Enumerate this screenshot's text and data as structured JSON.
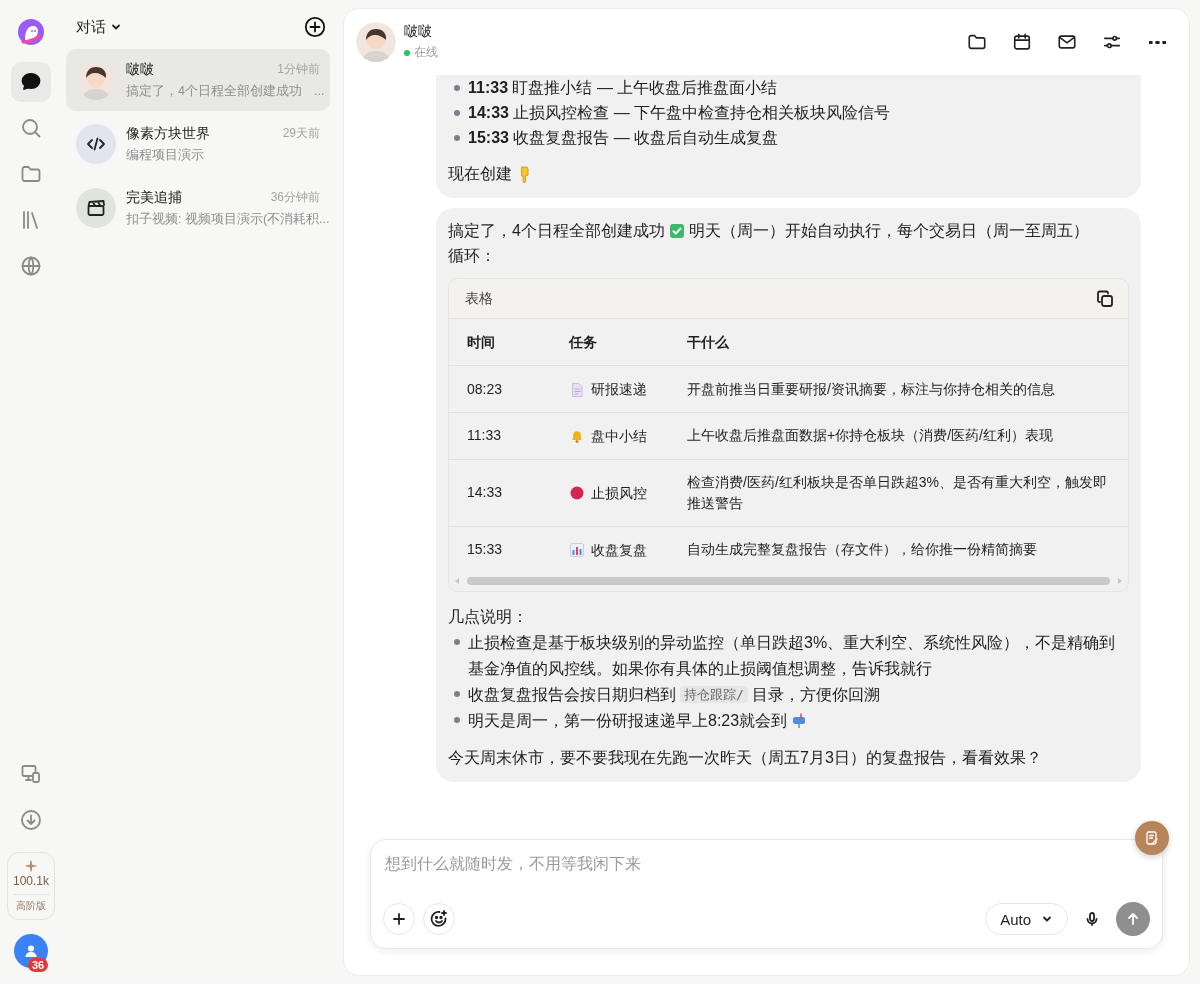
{
  "nav": [
    {
      "selected": true
    },
    {
      "selected": false
    },
    {
      "selected": false
    },
    {
      "selected": false
    },
    {
      "selected": false
    }
  ],
  "credits": {
    "amount": "100.1k",
    "plan": "高阶版"
  },
  "profile": {
    "badge": "36"
  },
  "conversations": {
    "title": "对话",
    "items": [
      {
        "name": "啵啵",
        "time": "1分钟前",
        "preview": "搞定了，4个日程全部创建成功",
        "preview_end": "...",
        "selected": true
      },
      {
        "name": "像素方块世界",
        "time": "29天前",
        "preview": "编程项目演示",
        "selected": false
      },
      {
        "name": "完美追捕",
        "time": "36分钟前",
        "preview": "扣子视频: 视频项目演示(不消耗积...",
        "selected": false
      }
    ]
  },
  "chat": {
    "name": "啵啵",
    "status": "在线"
  },
  "messages": [
    {
      "cut": true,
      "bullets": [
        "**11:33** 盯盘推小结 — 上午收盘后推盘面小结",
        "**14:33** 止损风控检查 — 下午盘中检查持仓相关板块风险信号",
        "**15:33** 收盘复盘报告 — 收盘后自动生成复盘"
      ],
      "closing": "现在创建"
    },
    {
      "cut": false,
      "intro": [
        "搞定了，4个日程全部创建成功",
        "明天（周一）开始自动执行，每个交易日（周一至周五）",
        "循环："
      ],
      "table": {
        "title": "表格",
        "columns": [
          "时间",
          "任务",
          "干什么"
        ],
        "rows": [
          {
            "time": "08:23",
            "task": "研报速递",
            "what": "开盘前推当日重要研报/资讯摘要，标注与你持仓相关的信息"
          },
          {
            "time": "11:33",
            "task": "盘中小结",
            "what": "上午收盘后推盘面数据+你持仓板块（消费/医药/红利）表现"
          },
          {
            "time": "14:33",
            "task": "止损风控",
            "what": "检查消费/医药/红利板块是否单日跌超3%、是否有重大利空，触发即推送警告"
          },
          {
            "time": "15:33",
            "task": "收盘复盘",
            "what": "自动生成完整复盘报告（存文件），给你推一份精简摘要"
          }
        ]
      },
      "notes_title": "几点说明：",
      "notes": [
        {
          "text": "止损检查是基于板块级别的异动监控（单日跌超3%、重大利空、系统性风险），不是精确到基金净值的风控线。如果你有具体的止损阈值想调整，告诉我就行"
        },
        {
          "text": "收盘复盘报告会按日期归档到",
          "code": "持仓跟踪/",
          "after": "目录，方便你回溯"
        },
        {
          "text": "明天是周一，第一份研报速递早上8:23就会到"
        }
      ],
      "closing": "今天周末休市，要不要我现在先跑一次昨天（周五7月3日）的复盘报告，看看效果？"
    }
  ],
  "composer": {
    "placeholder": "想到什么就随时发，不用等我闲下来",
    "model": "Auto"
  }
}
